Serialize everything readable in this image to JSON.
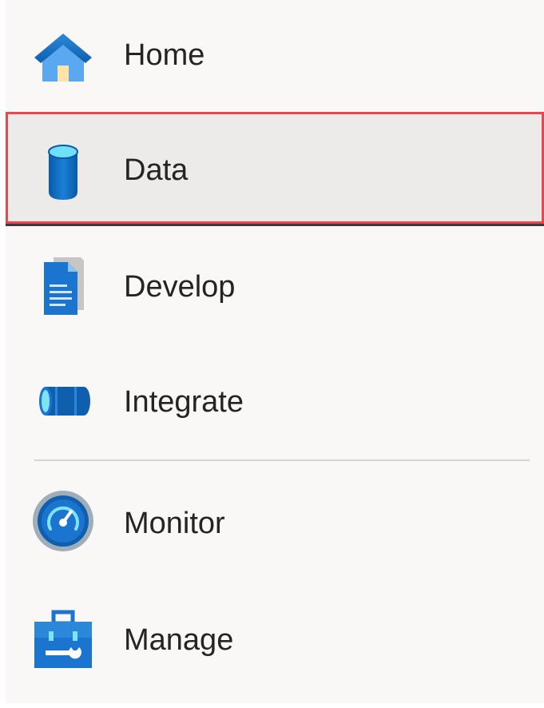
{
  "sidebar": {
    "items": [
      {
        "label": "Home",
        "icon": "home-icon"
      },
      {
        "label": "Data",
        "icon": "database-icon",
        "selected": true
      },
      {
        "label": "Develop",
        "icon": "document-icon"
      },
      {
        "label": "Integrate",
        "icon": "pipeline-icon"
      },
      {
        "label": "Monitor",
        "icon": "gauge-icon"
      },
      {
        "label": "Manage",
        "icon": "toolbox-icon"
      }
    ]
  },
  "colors": {
    "accent_blue": "#0f6cbd",
    "selection_outline": "#e9474e",
    "selected_background": "#edebe9",
    "nav_background": "#f9f8f7"
  }
}
